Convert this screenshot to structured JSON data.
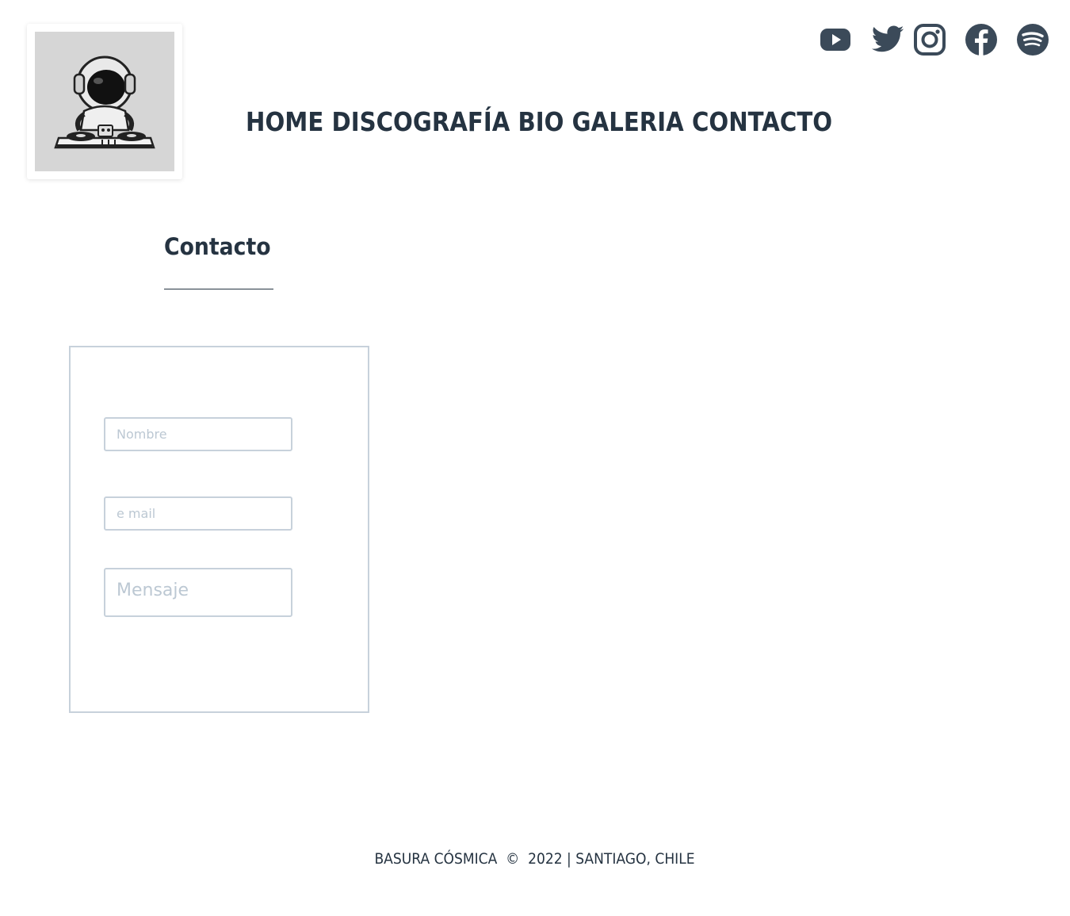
{
  "brand": {
    "logo_icon": "astronaut-dj-icon"
  },
  "social": {
    "items": [
      {
        "name": "youtube",
        "icon": "youtube-icon"
      },
      {
        "name": "twitter",
        "icon": "twitter-icon"
      },
      {
        "name": "instagram",
        "icon": "instagram-icon"
      },
      {
        "name": "facebook",
        "icon": "facebook-icon"
      },
      {
        "name": "spotify",
        "icon": "spotify-icon"
      }
    ],
    "color": "#3b4a59"
  },
  "nav": {
    "home": "HOME",
    "discografia": "DISCOGRAFÍA",
    "bio": "BIO",
    "galeria": "GALERIA",
    "contacto": "CONTACTO"
  },
  "section": {
    "title": "Contacto"
  },
  "form": {
    "name_placeholder": "Nombre",
    "email_placeholder": "e mail",
    "message_placeholder": "Mensaje"
  },
  "footer": {
    "text": "BASURA CÓSMICA  ©  2022 | SANTIAGO, CHILE"
  },
  "colors": {
    "text": "#253341",
    "border": "#c7d1db",
    "placeholder": "#bcc8d3",
    "logo_bg": "#d6d6d6"
  }
}
